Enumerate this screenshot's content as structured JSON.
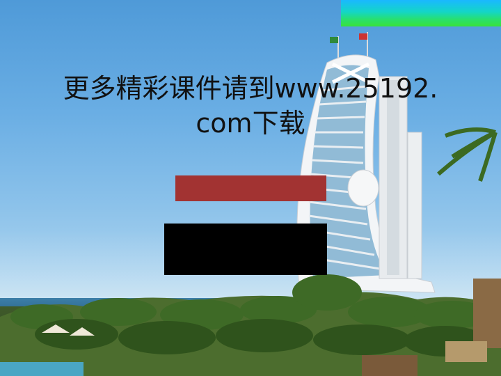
{
  "slide": {
    "title_line1": "更多精彩课件请到www.25192.",
    "title_line2": "com下载"
  },
  "colors": {
    "accent_gradient": [
      "#1ab8ff",
      "#39e23a"
    ],
    "red_box": "#a23332",
    "black_box": "#000000"
  }
}
